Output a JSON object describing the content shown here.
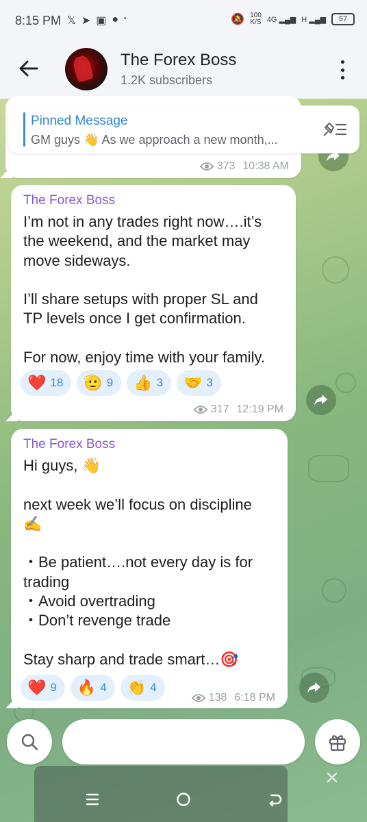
{
  "status_bar": {
    "time": "8:15 PM",
    "icons_left": [
      "x-icon",
      "telegram-icon",
      "sim-icon",
      "message-icon",
      "dot"
    ],
    "net_speed_value": "100",
    "net_speed_unit": "K/S",
    "network_label": "4G",
    "battery": "57"
  },
  "header": {
    "channel_name": "The Forex Boss",
    "subscribers": "1.2K subscribers"
  },
  "pinned": {
    "title": "Pinned Message",
    "text": "GM guys 👋  As we approach a new month,..."
  },
  "messages": [
    {
      "views": "373",
      "time": "10:38 AM"
    },
    {
      "sender": "The Forex Boss",
      "text": "I’m not in any trades right now….it’s\nthe weekend, and the market may\nmove sideways.\n\nI’ll share setups with proper SL and\nTP levels once I get confirmation.\n\nFor now, enjoy time with your family.",
      "reactions": [
        {
          "emoji": "❤️",
          "count": "18"
        },
        {
          "emoji": "🫡",
          "count": "9"
        },
        {
          "emoji": "👍",
          "count": "3"
        },
        {
          "emoji": "🤝",
          "count": "3"
        }
      ],
      "views": "317",
      "time": "12:19 PM"
    },
    {
      "sender": "The Forex Boss",
      "text": "Hi guys, 👋\n\nnext week we’ll focus on discipline\n✍️\n\n・Be patient….not every day is for\ntrading\n・Avoid overtrading\n・Don’t revenge trade\n\nStay sharp and trade smart…🎯",
      "reactions": [
        {
          "emoji": "❤️",
          "count": "9"
        },
        {
          "emoji": "🔥",
          "count": "4"
        },
        {
          "emoji": "👏",
          "count": "4"
        }
      ],
      "views": "138",
      "time": "6:18 PM"
    }
  ],
  "input": {
    "placeholder": ""
  },
  "colors": {
    "sender": "#8a57c9",
    "accent": "#2f84cf",
    "reaction_bg": "#e3effa"
  }
}
